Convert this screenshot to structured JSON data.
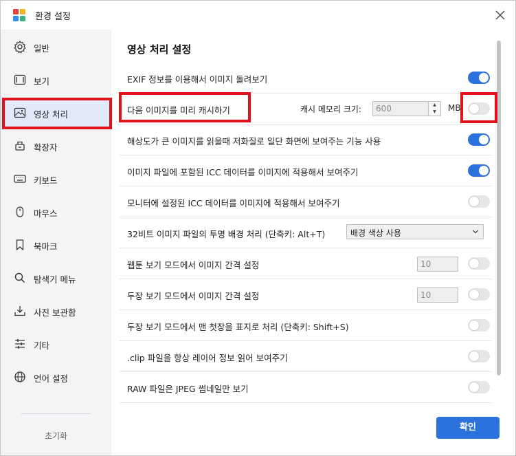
{
  "window": {
    "title": "환경 설정",
    "accent_color": "#2b72dc",
    "highlight_color": "#e0131b"
  },
  "sidebar": {
    "items": [
      {
        "label": "일반",
        "icon": "gear-icon"
      },
      {
        "label": "보기",
        "icon": "view-icon"
      },
      {
        "label": "영상 처리",
        "icon": "image-icon",
        "active": true
      },
      {
        "label": "확장자",
        "icon": "extension-icon"
      },
      {
        "label": "키보드",
        "icon": "keyboard-icon"
      },
      {
        "label": "마우스",
        "icon": "mouse-icon"
      },
      {
        "label": "북마크",
        "icon": "bookmark-icon"
      },
      {
        "label": "탐색기 메뉴",
        "icon": "search-icon"
      },
      {
        "label": "사진 보관함",
        "icon": "download-icon"
      },
      {
        "label": "기타",
        "icon": "sliders-icon"
      },
      {
        "label": "언어 설정",
        "icon": "globe-icon"
      }
    ],
    "reset_label": "초기화"
  },
  "main": {
    "section_title": "영상 처리 설정",
    "rows": [
      {
        "label": "EXIF 정보를 이용해서 이미지 돌려보기",
        "toggle_on": true
      },
      {
        "label": "다음 이미지를 미리 캐시하기",
        "toggle_on": false,
        "cache_label": "캐시 메모리 크기:",
        "cache_value": "600",
        "cache_unit": "MB"
      },
      {
        "label": "해상도가 큰 이미지를 읽을때 저화질로 일단 화면에 보여주는 기능 사용",
        "toggle_on": true
      },
      {
        "label": "이미지 파일에 포함된 ICC 데이터를 이미지에 적용해서 보여주기",
        "toggle_on": true
      },
      {
        "label": "모니터에 설정된 ICC 데이터를 이미지에 적용해서 보여주기",
        "toggle_on": false
      },
      {
        "label": "32비트 이미지 파일의 투명 배경 처리 (단축키: Alt+T)",
        "select_value": "배경 색상 사용"
      },
      {
        "label": "웹툰 보기 모드에서 이미지 간격 설정",
        "toggle_on": false,
        "input_value": "10"
      },
      {
        "label": "두장 보기 모드에서 이미지 간격 설정",
        "toggle_on": false,
        "input_value": "10"
      },
      {
        "label": "두장 보기 모드에서 맨 첫장을 표지로 처리 (단축키: Shift+S)",
        "toggle_on": false
      },
      {
        "label": ".clip 파일을 항상 레이어 정보 읽어 보여주기",
        "toggle_on": false
      },
      {
        "label": "RAW 파일은 JPEG 썸네일만 보기",
        "toggle_on": false
      }
    ],
    "ok_label": "확인"
  }
}
